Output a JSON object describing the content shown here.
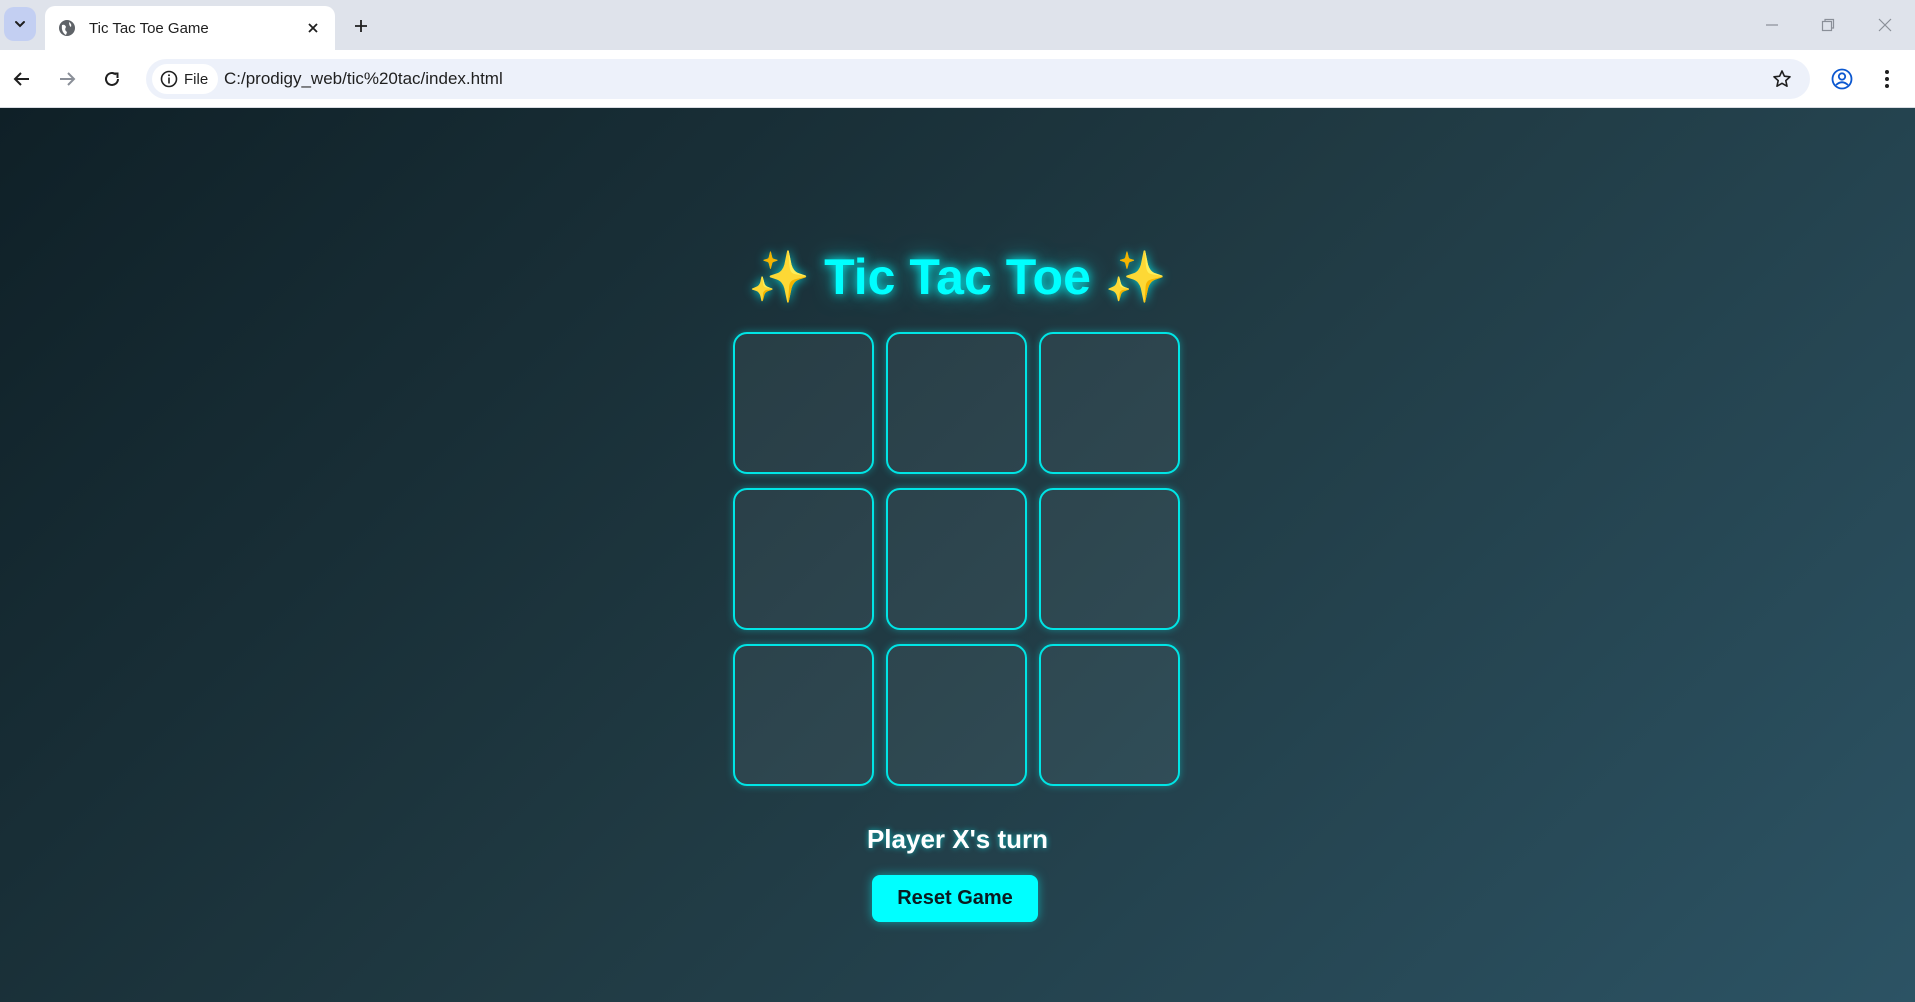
{
  "browser": {
    "tab": {
      "title": "Tic Tac Toe Game"
    },
    "address_bar": {
      "chip_label": "File",
      "url": "C:/prodigy_web/tic%20tac/index.html"
    },
    "icons": [
      "tab-search-icon",
      "globe-icon",
      "close-icon",
      "plus-icon",
      "minimize-icon",
      "restore-icon",
      "window-close-icon",
      "back-arrow-icon",
      "forward-arrow-icon",
      "reload-icon",
      "info-icon",
      "star-icon",
      "profile-icon",
      "menu-dots-icon"
    ]
  },
  "game": {
    "title_text": "Tic Tac Toe",
    "title_sparkle": "✨",
    "cells": [
      "",
      "",
      "",
      "",
      "",
      "",
      "",
      "",
      ""
    ],
    "status": "Player X's turn",
    "reset_label": "Reset Game"
  },
  "colors": {
    "accent": "#00ffff",
    "gradient": [
      "#0f2027",
      "#203a43",
      "#2c5364"
    ]
  }
}
